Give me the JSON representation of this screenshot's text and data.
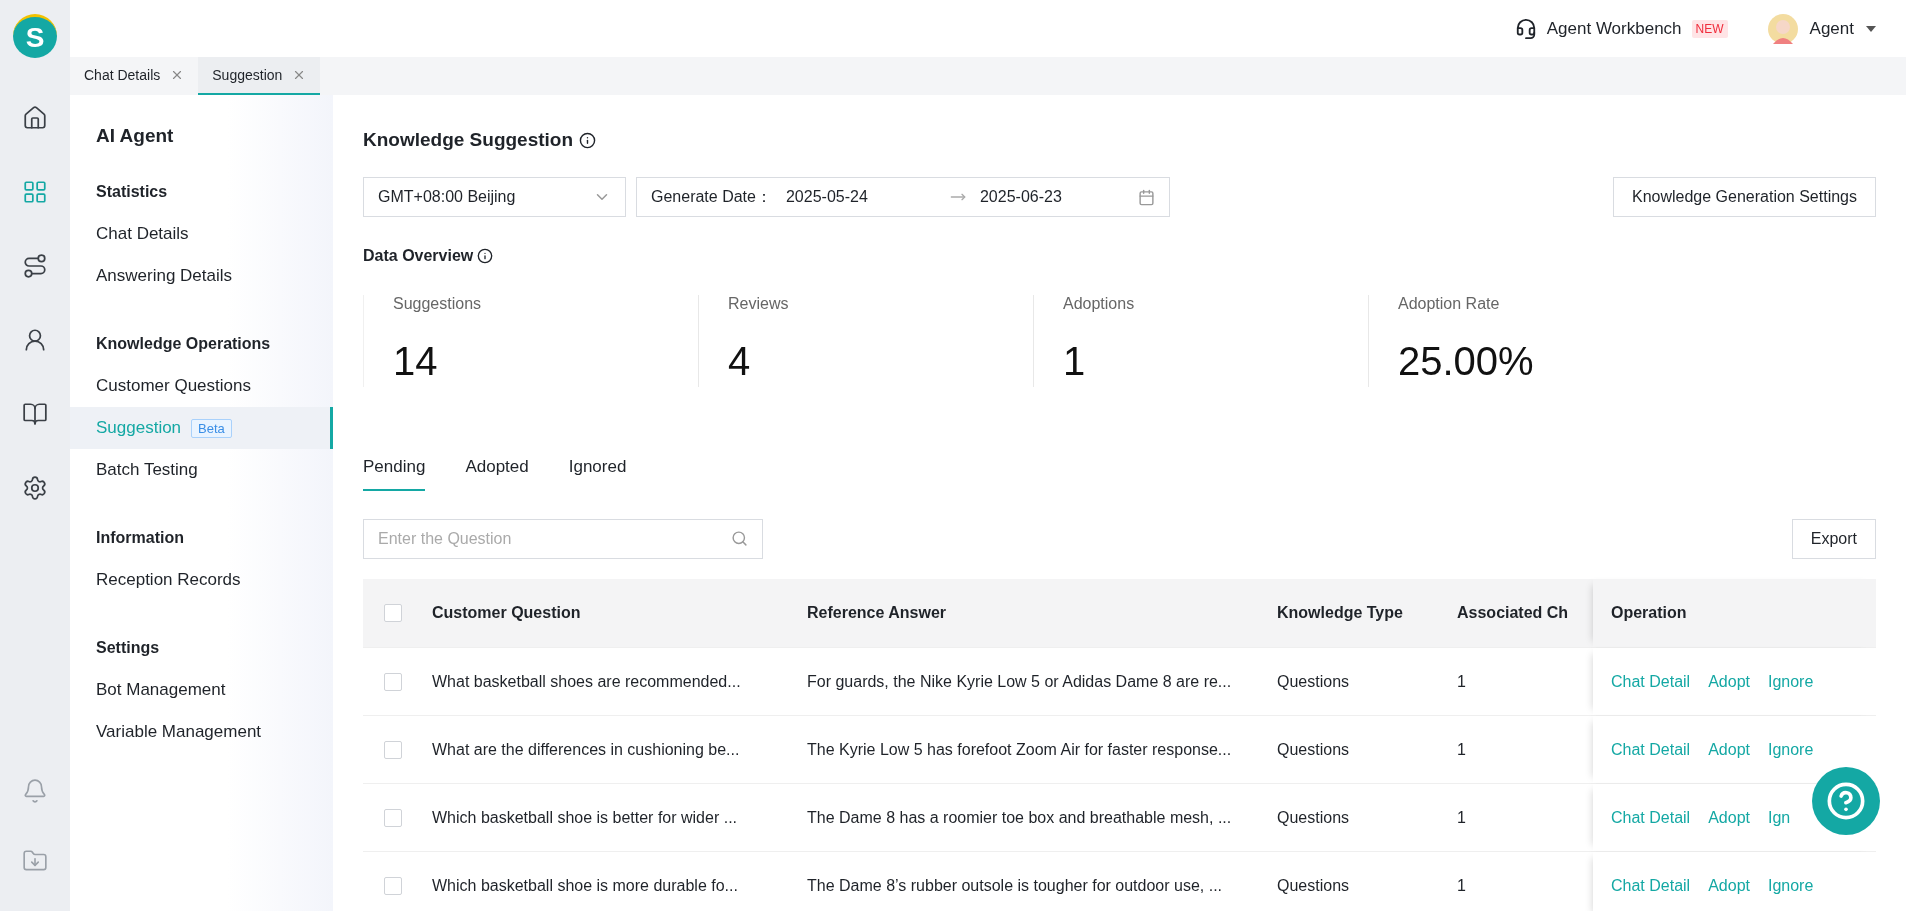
{
  "app": {
    "logo": "S"
  },
  "rail": [
    {
      "kind": "home",
      "selected": false
    },
    {
      "kind": "apps",
      "selected": true
    },
    {
      "kind": "route",
      "selected": false
    },
    {
      "kind": "agent",
      "selected": false
    },
    {
      "kind": "book",
      "selected": false
    },
    {
      "kind": "settings",
      "selected": false
    }
  ],
  "rail_bottom": [
    {
      "kind": "bell"
    },
    {
      "kind": "download"
    }
  ],
  "header": {
    "workbench": "Agent Workbench",
    "workbench_badge": "NEW",
    "user": "Agent"
  },
  "page_tabs": [
    {
      "label": "Chat Details",
      "selected": false
    },
    {
      "label": "Suggestion",
      "selected": true
    }
  ],
  "nav": {
    "title": "AI Agent",
    "sections": [
      {
        "heading": "Statistics",
        "items": [
          {
            "label": "Chat Details",
            "selected": false
          },
          {
            "label": "Answering Details",
            "selected": false
          }
        ]
      },
      {
        "heading": "Knowledge Operations",
        "items": [
          {
            "label": "Customer Questions",
            "selected": false
          },
          {
            "label": "Suggestion",
            "badge": "Beta",
            "selected": true
          },
          {
            "label": "Batch Testing",
            "selected": false
          }
        ]
      },
      {
        "heading": "Information",
        "items": [
          {
            "label": "Reception Records",
            "selected": false
          }
        ]
      },
      {
        "heading": "Settings",
        "items": [
          {
            "label": "Bot Management",
            "selected": false
          },
          {
            "label": "Variable Management",
            "selected": false
          }
        ]
      }
    ]
  },
  "page": {
    "title": "Knowledge Suggestion",
    "timezone": "GMT+08:00 Beijing",
    "date_label": "Generate Date：",
    "date_start": "2025-05-24",
    "date_end": "2025-06-23",
    "settings_button": "Knowledge Generation Settings",
    "overview_title": "Data Overview",
    "stats": [
      {
        "label": "Suggestions",
        "value": "14"
      },
      {
        "label": "Reviews",
        "value": "4"
      },
      {
        "label": "Adoptions",
        "value": "1"
      },
      {
        "label": "Adoption Rate",
        "value": "25.00%"
      }
    ]
  },
  "status_tabs": [
    {
      "label": "Pending",
      "selected": true
    },
    {
      "label": "Adopted",
      "selected": false
    },
    {
      "label": "Ignored",
      "selected": false
    }
  ],
  "search": {
    "placeholder": "Enter the Question"
  },
  "export_button": "Export",
  "table": {
    "header_checked": false,
    "columns": [
      "Customer Question",
      "Reference Answer",
      "Knowledge Type",
      "Associated Ch",
      "Operation"
    ],
    "rows": [
      {
        "checked": false,
        "cells": [
          "What basketball shoes are recommended...",
          "For guards, the Nike Kyrie Low 5 or Adidas Dame 8 are re...",
          "Questions",
          "1"
        ],
        "actions": [
          "Chat Detail",
          "Adopt",
          "Ignore"
        ]
      },
      {
        "checked": false,
        "cells": [
          "What are the differences in cushioning be...",
          "The Kyrie Low 5 has forefoot Zoom Air for faster response...",
          "Questions",
          "1"
        ],
        "actions": [
          "Chat Detail",
          "Adopt",
          "Ignore"
        ]
      },
      {
        "checked": false,
        "cells": [
          "Which basketball shoe is better for wider ...",
          "The Dame 8 has a roomier toe box and breathable mesh, ...",
          "Questions",
          "1"
        ],
        "actions": [
          "Chat Detail",
          "Adopt",
          "Ign"
        ]
      },
      {
        "checked": false,
        "cells": [
          "Which basketball shoe is more durable fo...",
          "The Dame 8’s rubber outsole is tougher for outdoor use, ...",
          "Questions",
          "1"
        ],
        "actions": [
          "Chat Detail",
          "Adopt",
          "Ignore"
        ]
      }
    ]
  }
}
